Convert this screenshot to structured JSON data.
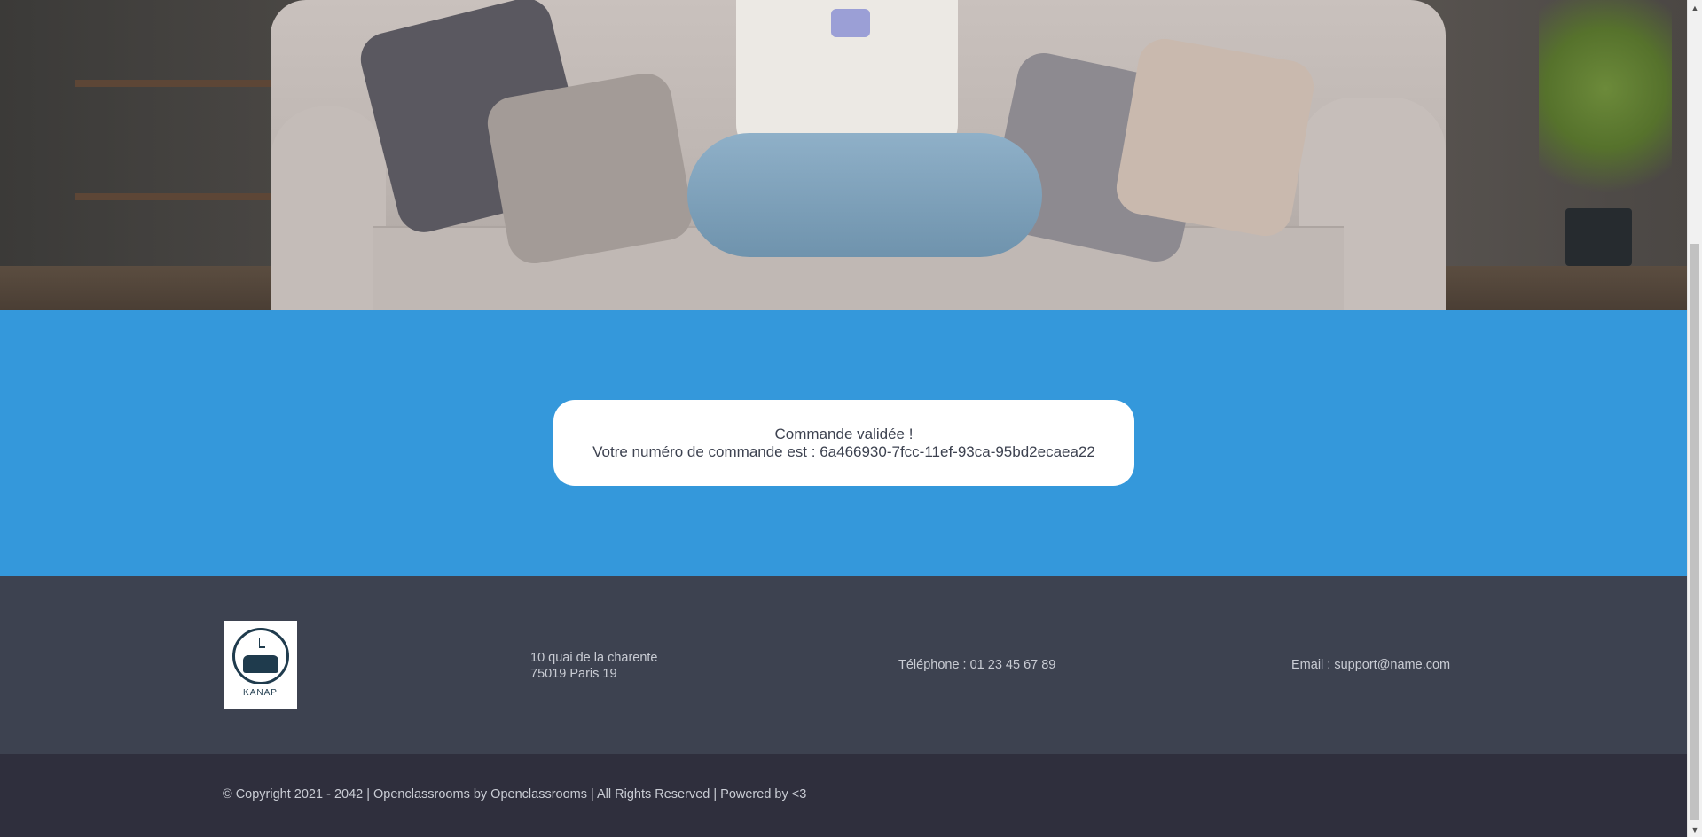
{
  "confirmation": {
    "title": "Commande validée !",
    "order_label": "Votre numéro de commande est : 6a466930-7fcc-11ef-93ca-95bd2ecaea22"
  },
  "footer": {
    "logo_text": "KANAP",
    "address_line1": "10 quai de la charente",
    "address_line2": "75019 Paris 19",
    "phone": "Téléphone : 01 23 45 67 89",
    "email": "Email : support@name.com",
    "copyright": "© Copyright 2021 - 2042 | Openclassrooms by Openclassrooms | All Rights Reserved | Powered by <3"
  },
  "scrollbar": {
    "up_icon": "▲",
    "down_icon": "▼"
  },
  "colors": {
    "band": "#3498db",
    "footer_main": "#3d4250",
    "footer_bottom": "#2f2f3d"
  }
}
